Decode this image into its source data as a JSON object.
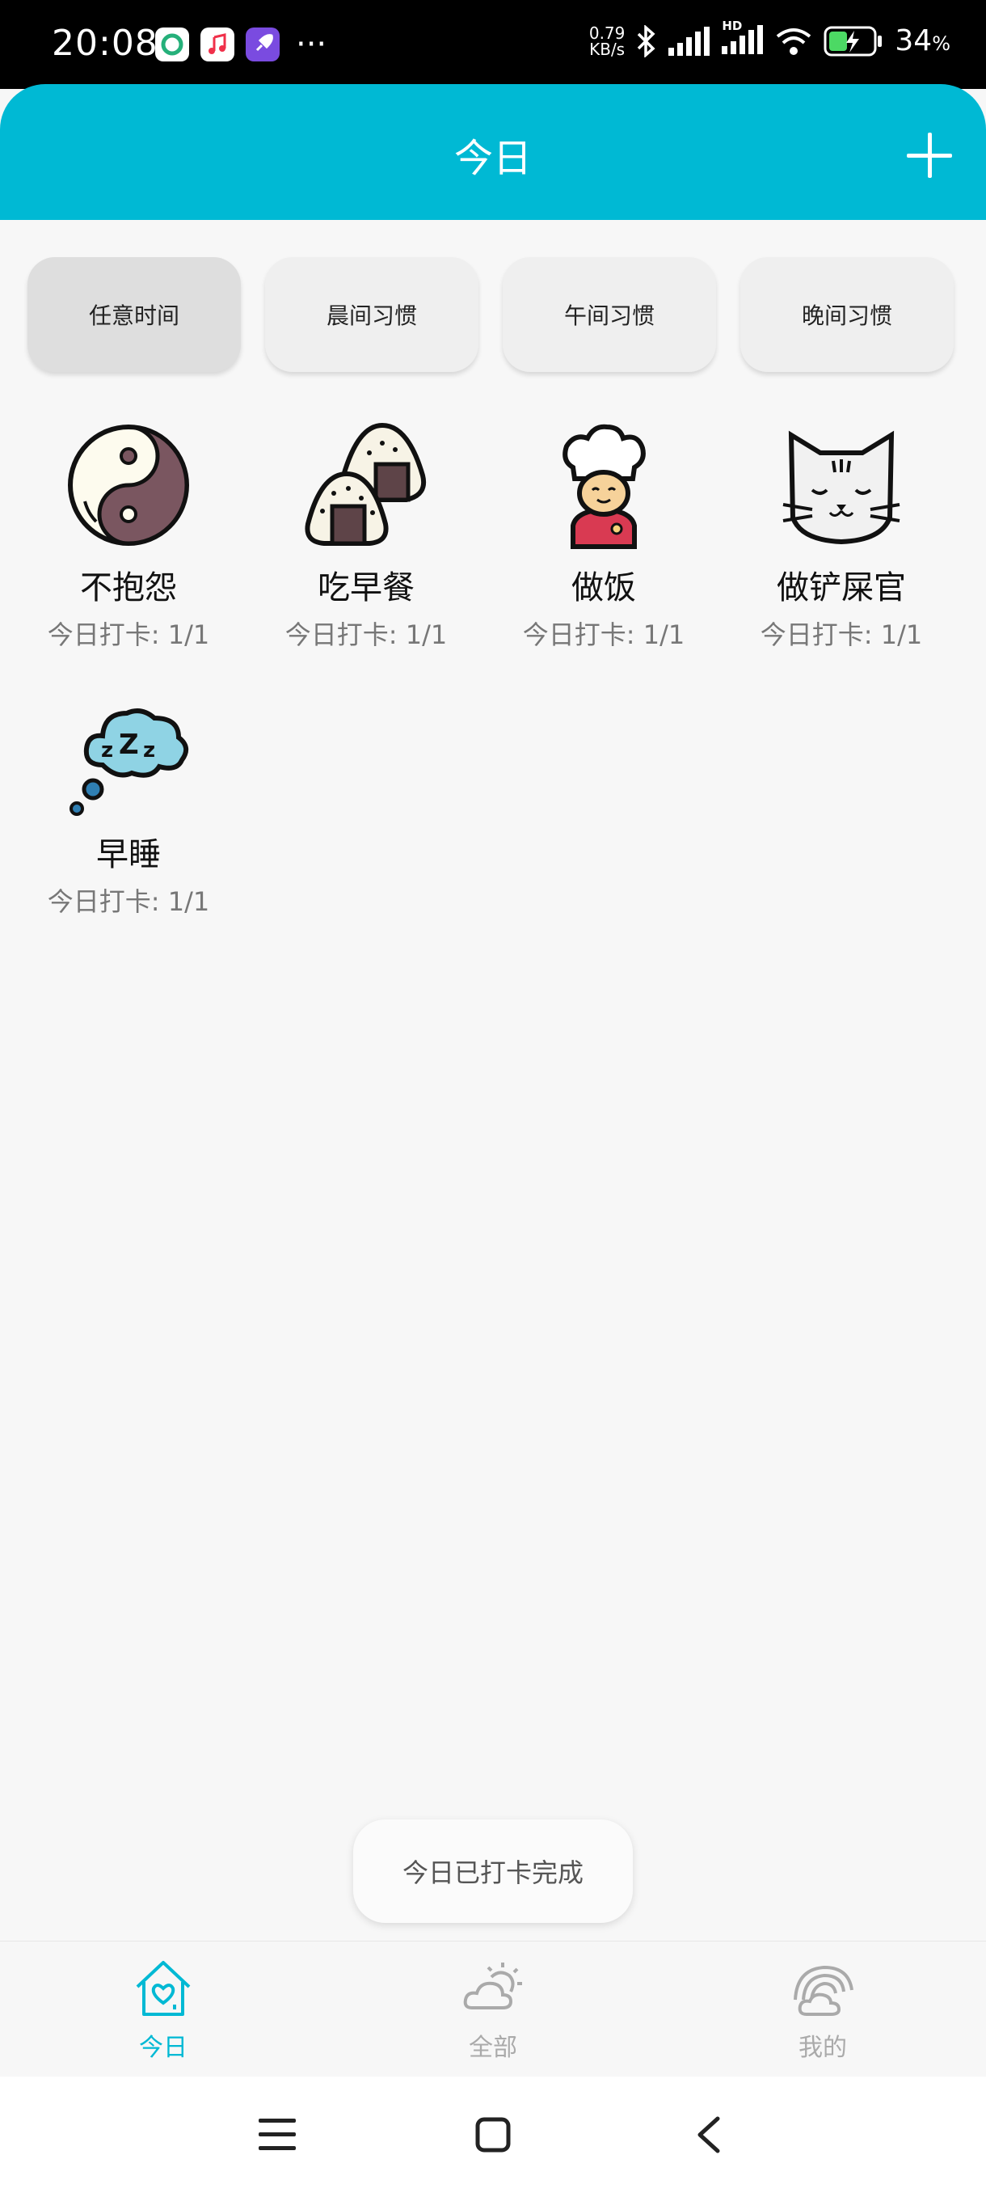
{
  "status_bar": {
    "time": "20:08",
    "speed_value": "0.79",
    "speed_unit": "KB/s",
    "network_label": "HD",
    "battery_percent": "34",
    "battery_unit": "%",
    "more": "···"
  },
  "header": {
    "title": "今日"
  },
  "filters": [
    {
      "label": "任意时间",
      "active": true
    },
    {
      "label": "晨间习惯",
      "active": false
    },
    {
      "label": "午间习惯",
      "active": false
    },
    {
      "label": "晚间习惯",
      "active": false
    }
  ],
  "habits": [
    {
      "name": "不抱怨",
      "count": "今日打卡: 1/1",
      "icon": "yin-yang-icon"
    },
    {
      "name": "吃早餐",
      "count": "今日打卡: 1/1",
      "icon": "rice-ball-icon"
    },
    {
      "name": "做饭",
      "count": "今日打卡: 1/1",
      "icon": "chef-icon"
    },
    {
      "name": "做铲屎官",
      "count": "今日打卡: 1/1",
      "icon": "cat-icon"
    },
    {
      "name": "早睡",
      "count": "今日打卡: 1/1",
      "icon": "sleep-cloud-icon"
    }
  ],
  "toast": {
    "text": "今日已打卡完成"
  },
  "bottom_nav": [
    {
      "label": "今日",
      "icon": "home-heart-icon",
      "active": true
    },
    {
      "label": "全部",
      "icon": "sun-cloud-icon",
      "active": false
    },
    {
      "label": "我的",
      "icon": "rainbow-cloud-icon",
      "active": false
    }
  ],
  "colors": {
    "accent": "#00b9d4",
    "inactive": "#aaaaaa"
  }
}
